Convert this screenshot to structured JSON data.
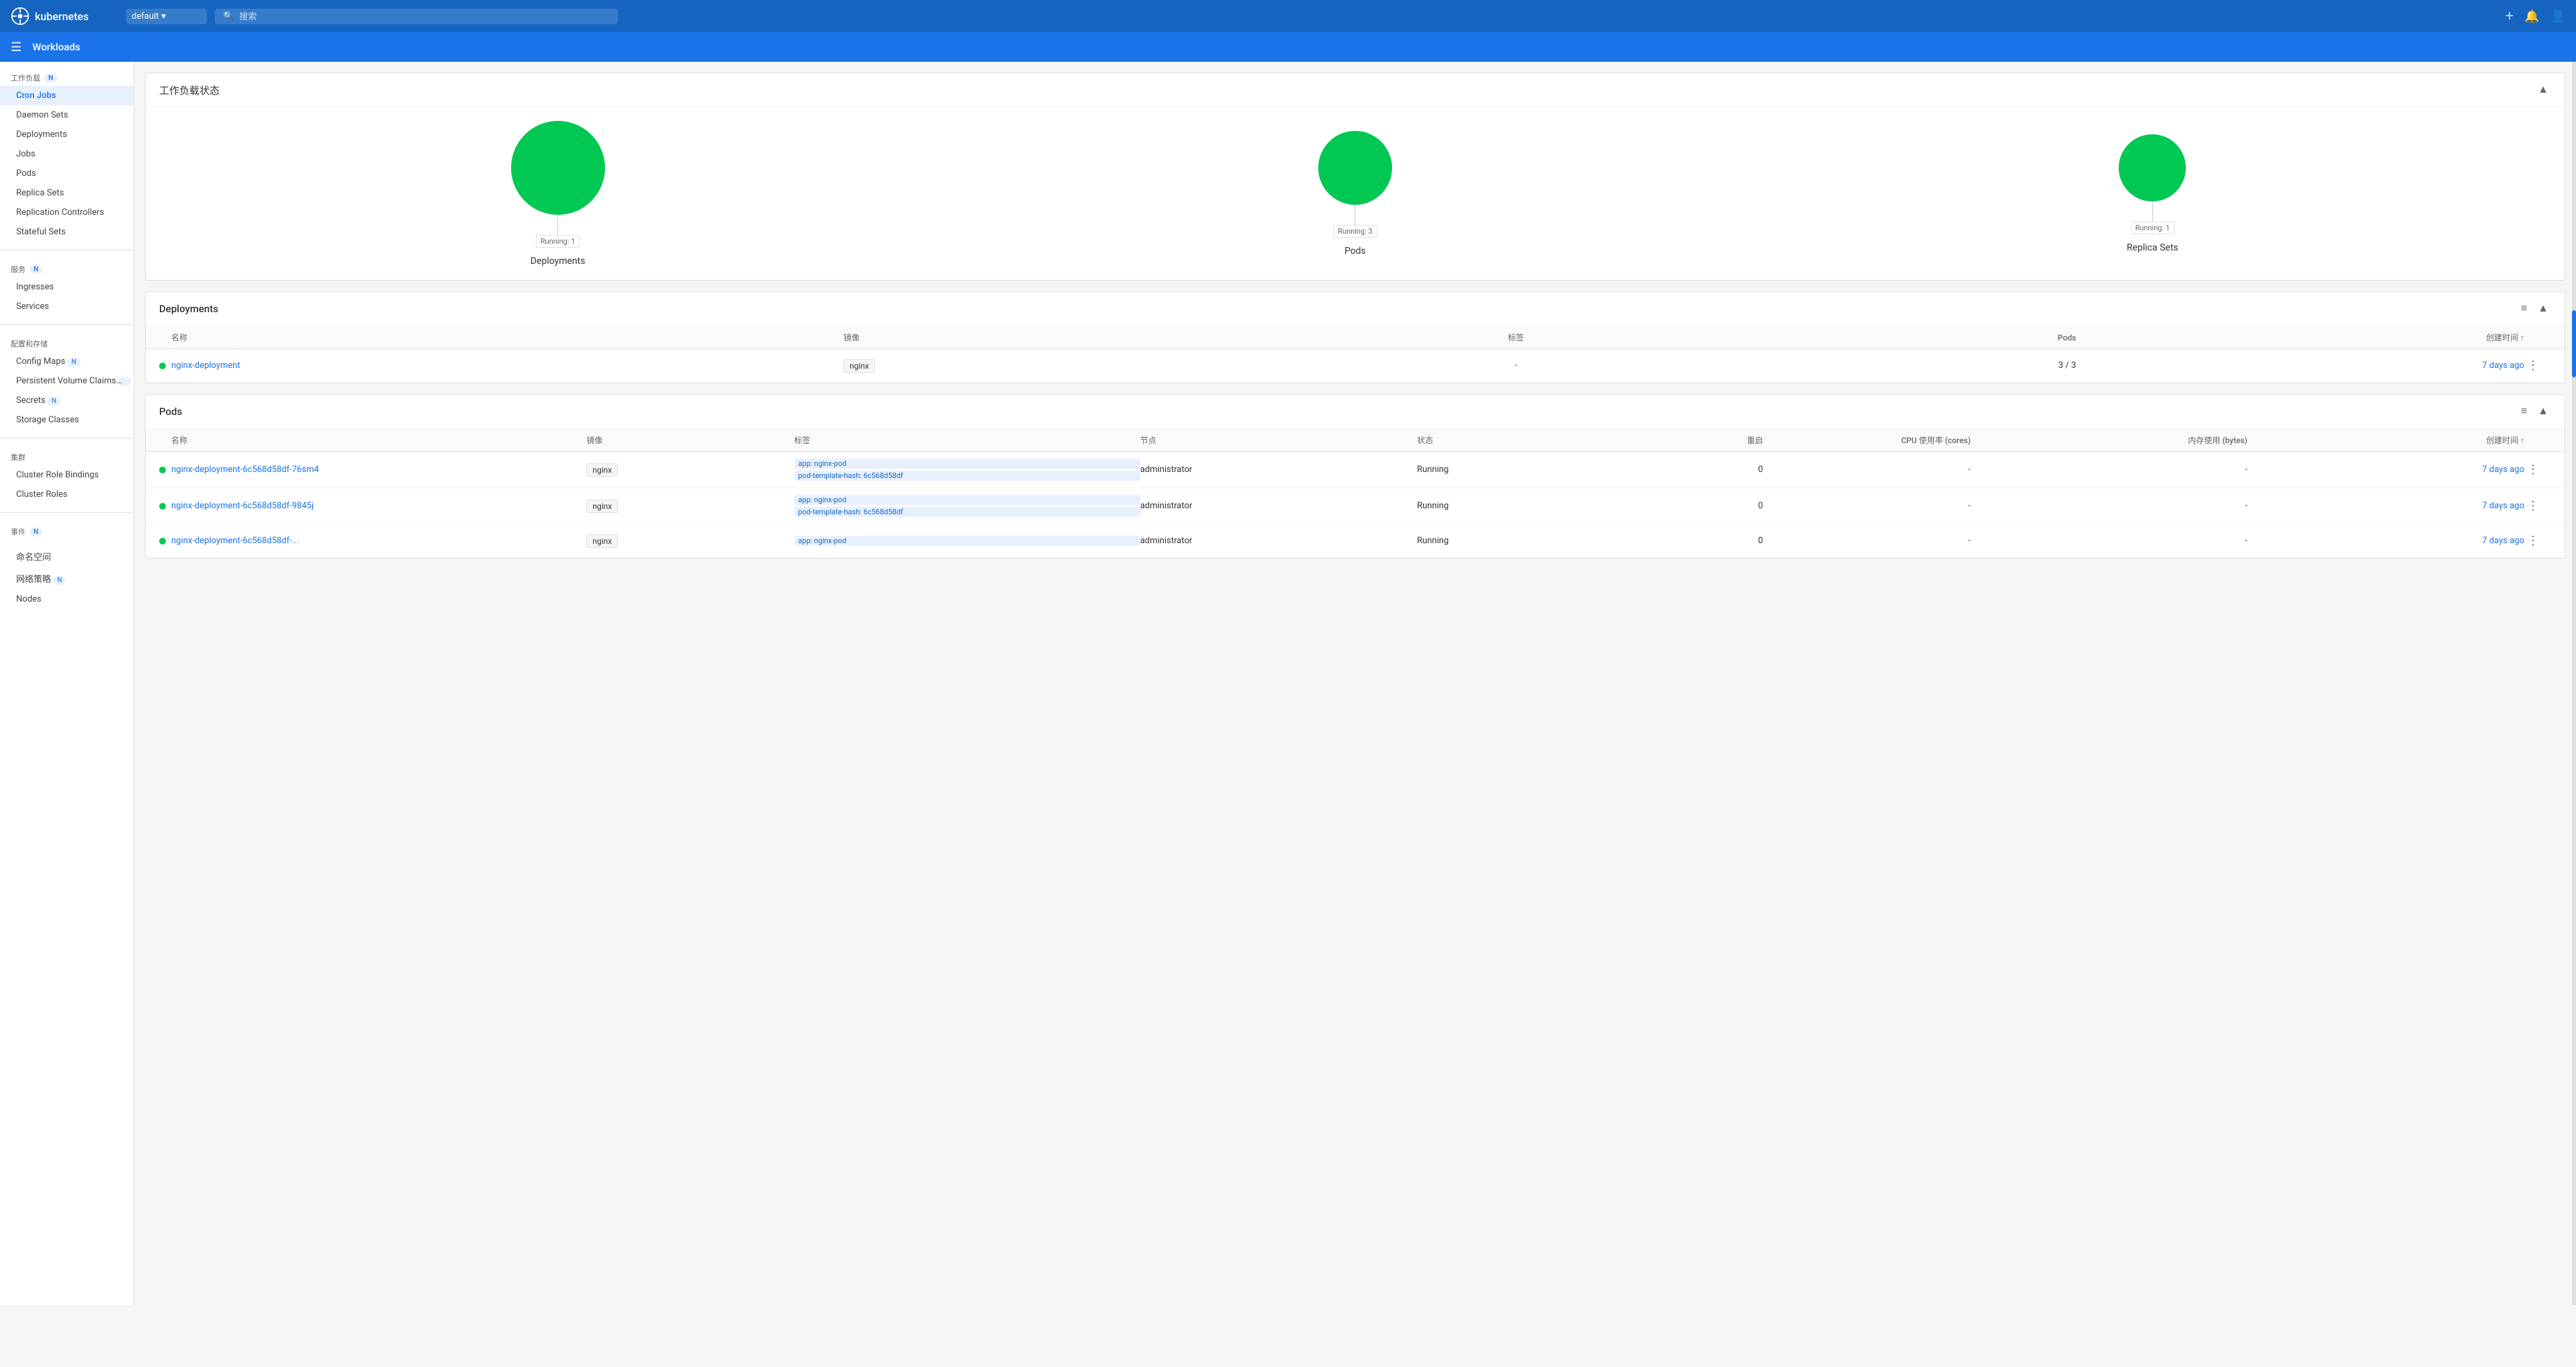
{
  "topbar": {
    "logo": "kubernetes",
    "namespace": "default",
    "search_placeholder": "搜索",
    "add_label": "+",
    "bell_label": "🔔",
    "user_label": "👤"
  },
  "breadcrumb": {
    "menu_icon": "☰",
    "title": "Workloads"
  },
  "sidebar": {
    "section_workloads": "工作负载",
    "section_workloads_badge": "N",
    "items_workloads": [
      {
        "label": "Cron Jobs",
        "active": false
      },
      {
        "label": "Daemon Sets",
        "active": false
      },
      {
        "label": "Deployments",
        "active": false
      },
      {
        "label": "Jobs",
        "active": false
      },
      {
        "label": "Pods",
        "active": false
      },
      {
        "label": "Replica Sets",
        "active": false
      },
      {
        "label": "Replication Controllers",
        "active": false
      },
      {
        "label": "Stateful Sets",
        "active": false
      }
    ],
    "section_services": "服务",
    "section_services_badge": "N",
    "items_services": [
      {
        "label": "Ingresses",
        "active": false
      },
      {
        "label": "Services",
        "active": false
      }
    ],
    "section_config": "配置和存储",
    "items_config": [
      {
        "label": "Config Maps",
        "badge": "N",
        "active": false
      },
      {
        "label": "Persistent Volume Claims",
        "badge": "N",
        "active": false
      },
      {
        "label": "Secrets",
        "badge": "N",
        "active": false
      },
      {
        "label": "Storage Classes",
        "active": false
      }
    ],
    "section_cluster": "集群",
    "items_cluster": [
      {
        "label": "Cluster Role Bindings",
        "active": false
      },
      {
        "label": "Cluster Roles",
        "active": false
      }
    ],
    "section_events": "事件",
    "section_events_badge": "N",
    "section_namespace": "命名空间",
    "section_netpolicy": "网络策略",
    "section_netpolicy_badge": "N",
    "section_nodes": "Nodes"
  },
  "workload_status": {
    "title": "工作负载状态",
    "items": [
      {
        "name": "Deployments",
        "running_label": "Running: 1",
        "size": "large"
      },
      {
        "name": "Pods",
        "running_label": "Running: 3",
        "size": "medium"
      },
      {
        "name": "Replica Sets",
        "running_label": "Running: 1",
        "size": "small"
      }
    ]
  },
  "deployments": {
    "title": "Deployments",
    "columns": [
      "名称",
      "镜像",
      "标签",
      "Pods",
      "创建时间 ↑"
    ],
    "rows": [
      {
        "status": "running",
        "name": "nginx-deployment",
        "image": "nginx",
        "labels": "-",
        "pods": "3 / 3",
        "time": "7 days ago"
      }
    ]
  },
  "pods": {
    "title": "Pods",
    "columns": [
      "名称",
      "镜像",
      "标签",
      "节点",
      "状态",
      "重启",
      "CPU 使用率 (cores)",
      "内存使用 (bytes)",
      "创建时间 ↑"
    ],
    "rows": [
      {
        "status": "running",
        "name": "nginx-deployment-6c568d58df-76sm4",
        "image": "nginx",
        "labels": [
          "app: nginx-pod",
          "pod-template-hash: 6c568d58df"
        ],
        "node": "administrator",
        "state": "Running",
        "restart": "0",
        "cpu": "-",
        "mem": "-",
        "time": "7 days ago"
      },
      {
        "status": "running",
        "name": "nginx-deployment-6c568d58df-9845j",
        "image": "nginx",
        "labels": [
          "app: nginx-pod",
          "pod-template-hash: 6c568d58df"
        ],
        "node": "administrator",
        "state": "Running",
        "restart": "0",
        "cpu": "-",
        "mem": "-",
        "time": "7 days ago"
      },
      {
        "status": "running",
        "name": "nginx-deployment-6c568d58df-...",
        "image": "nginx",
        "labels": [
          "app: nginx-pod"
        ],
        "node": "administrator",
        "state": "Running",
        "restart": "0",
        "cpu": "-",
        "mem": "-",
        "time": "7 days ago"
      }
    ]
  }
}
